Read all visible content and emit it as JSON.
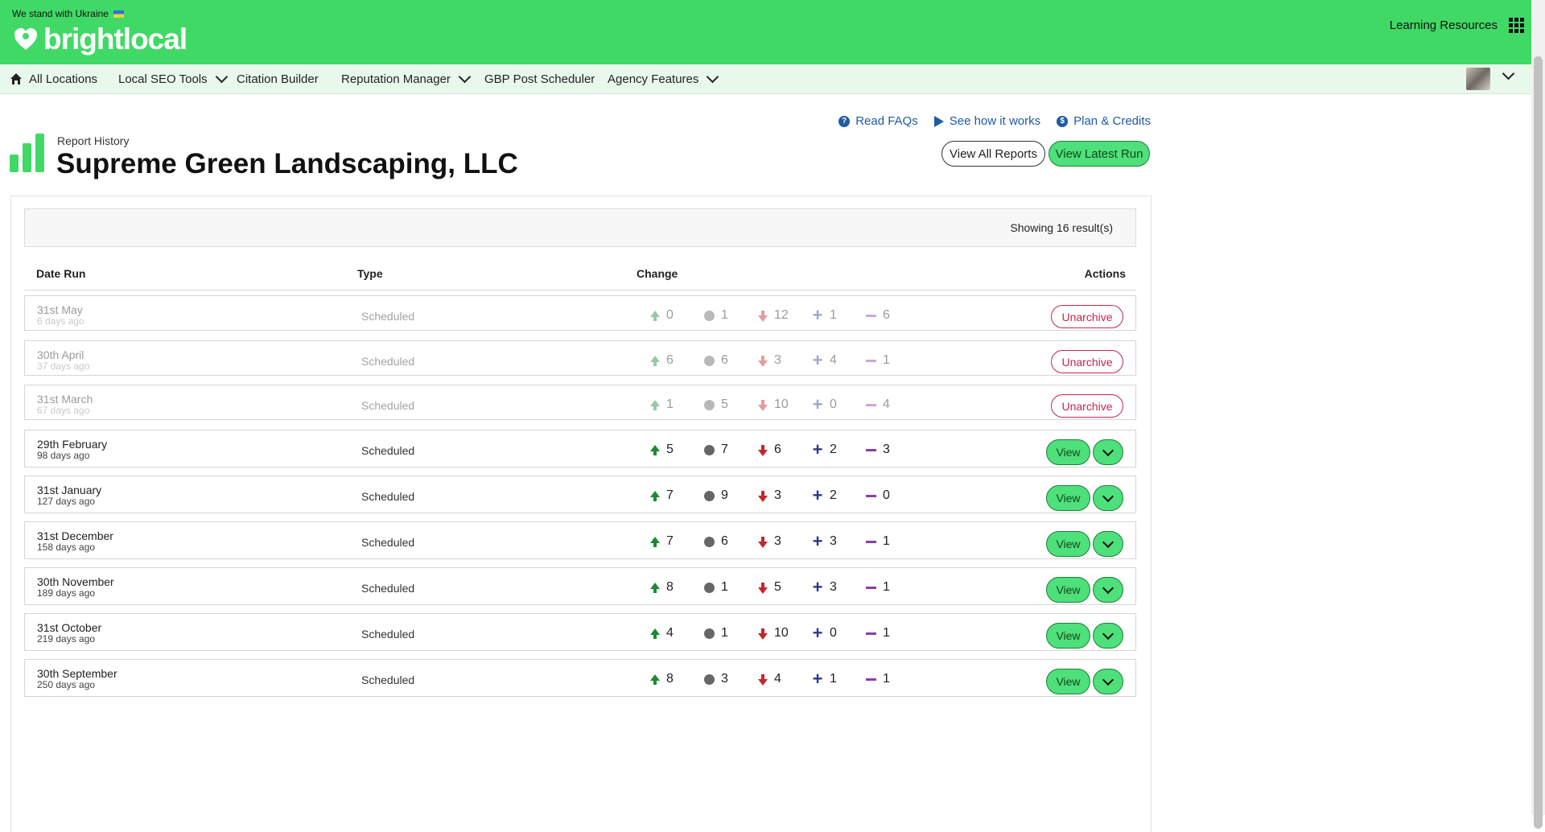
{
  "header": {
    "ukraine_text": "We stand with Ukraine",
    "logo_text": "brightlocal",
    "learning_resources": "Learning Resources",
    "brand_color": "#40d966"
  },
  "nav": {
    "items": [
      {
        "label": "All Locations",
        "icon": "home-icon"
      },
      {
        "label": "Local SEO Tools",
        "dropdown": true
      },
      {
        "label": "Citation Builder"
      },
      {
        "label": "Reputation Manager",
        "dropdown": true
      },
      {
        "label": "GBP Post Scheduler"
      },
      {
        "label": "Agency Features",
        "dropdown": true
      }
    ]
  },
  "page": {
    "breadcrumb": "Report History",
    "title": "Supreme Green Landscaping, LLC",
    "links": {
      "faqs": "Read FAQs",
      "how_it_works": "See how it works",
      "plan_credits": "Plan & Credits"
    },
    "buttons": {
      "view_all": "View All Reports",
      "view_latest": "View Latest Run"
    }
  },
  "table": {
    "results_text": "Showing 16 result(s)",
    "headers": {
      "date": "Date Run",
      "type": "Type",
      "change": "Change",
      "actions": "Actions"
    },
    "action_labels": {
      "unarchive": "Unarchive",
      "view": "View"
    },
    "rows": [
      {
        "date": "31st May",
        "ago": "6 days ago",
        "type": "Scheduled",
        "up": "0",
        "same": "1",
        "down": "12",
        "new": "1",
        "lost": "6",
        "archived": true
      },
      {
        "date": "30th April",
        "ago": "37 days ago",
        "type": "Scheduled",
        "up": "6",
        "same": "6",
        "down": "3",
        "new": "4",
        "lost": "1",
        "archived": true
      },
      {
        "date": "31st March",
        "ago": "67 days ago",
        "type": "Scheduled",
        "up": "1",
        "same": "5",
        "down": "10",
        "new": "0",
        "lost": "4",
        "archived": true
      },
      {
        "date": "29th February",
        "ago": "98 days ago",
        "type": "Scheduled",
        "up": "5",
        "same": "7",
        "down": "6",
        "new": "2",
        "lost": "3",
        "archived": false
      },
      {
        "date": "31st January",
        "ago": "127 days ago",
        "type": "Scheduled",
        "up": "7",
        "same": "9",
        "down": "3",
        "new": "2",
        "lost": "0",
        "archived": false
      },
      {
        "date": "31st December",
        "ago": "158 days ago",
        "type": "Scheduled",
        "up": "7",
        "same": "6",
        "down": "3",
        "new": "3",
        "lost": "1",
        "archived": false
      },
      {
        "date": "30th November",
        "ago": "189 days ago",
        "type": "Scheduled",
        "up": "8",
        "same": "1",
        "down": "5",
        "new": "3",
        "lost": "1",
        "archived": false
      },
      {
        "date": "31st October",
        "ago": "219 days ago",
        "type": "Scheduled",
        "up": "4",
        "same": "1",
        "down": "10",
        "new": "0",
        "lost": "1",
        "archived": false
      },
      {
        "date": "30th September",
        "ago": "250 days ago",
        "type": "Scheduled",
        "up": "8",
        "same": "3",
        "down": "4",
        "new": "1",
        "lost": "1",
        "archived": false
      }
    ]
  }
}
